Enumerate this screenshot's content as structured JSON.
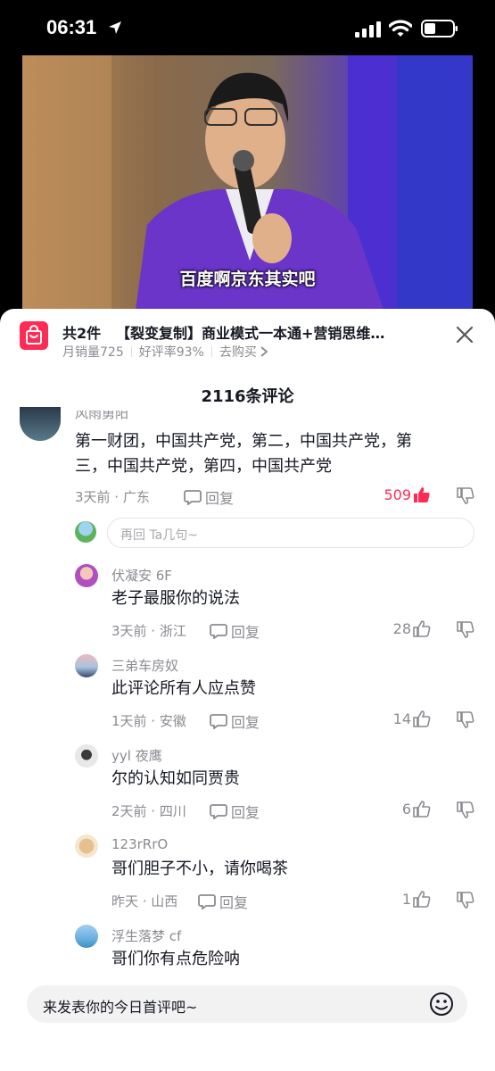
{
  "status_bar": {
    "time": "06:31"
  },
  "video": {
    "subtitle": "百度啊京东其实吧"
  },
  "product": {
    "count": "共2件",
    "title": "【裂变复制】商业模式一本通+营销思维…",
    "monthly_sales": "月销量725",
    "rating": "好评率93%",
    "buy_link": "去购买"
  },
  "comments_header": "2116条评论",
  "top_comment": {
    "nickname": "风雨勇阳",
    "text_line1": "第一财团，中国共产党，第二，中国共产党，第",
    "text_line2": "三，中国共产党，第四，中国共产党",
    "time_location": "3天前 · 广东",
    "reply_label": "回复",
    "likes": "509"
  },
  "reply_box_placeholder": "再回 Ta几句~",
  "replies": [
    {
      "nickname": "伏凝安 6F",
      "text": "老子最服你的说法",
      "time_location": "3天前 · 浙江",
      "reply_label": "回复",
      "likes": "28"
    },
    {
      "nickname": "三弟车房奴",
      "text": "此评论所有人应点赞",
      "time_location": "1天前 · 安徽",
      "reply_label": "回复",
      "likes": "14"
    },
    {
      "nickname": "yyl 夜鹰",
      "text": "尔的认知如同贾贵",
      "time_location": "2天前 · 四川",
      "reply_label": "回复",
      "likes": "6"
    },
    {
      "nickname": "123rRrO",
      "text": "哥们胆子不小，请你喝茶",
      "time_location": "昨天 · 山西",
      "reply_label": "回复",
      "likes": "1"
    },
    {
      "nickname": "浮生落梦 cf",
      "text": "哥们你有点危险呐"
    }
  ],
  "comment_input_placeholder": "来发表你的今日首评吧~",
  "colors": {
    "accent": "#fe2c55",
    "text": "#161823",
    "secondary": "#8a8b91"
  }
}
